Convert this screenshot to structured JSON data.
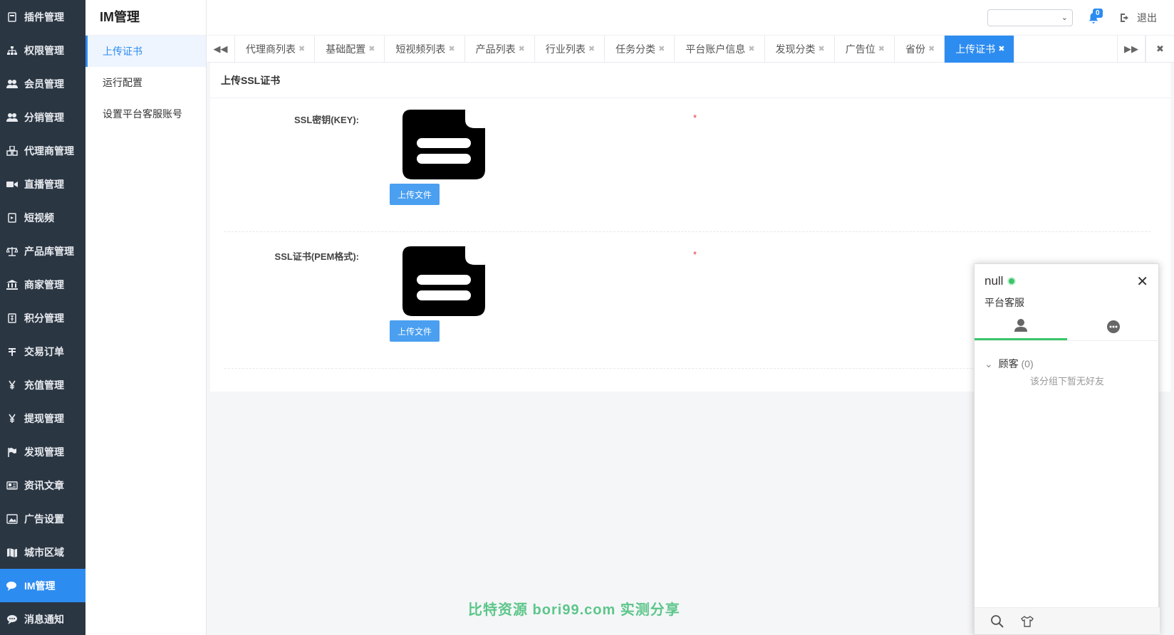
{
  "sidebar": {
    "items": [
      {
        "label": "插件管理",
        "icon": "plugin-icon"
      },
      {
        "label": "权限管理",
        "icon": "sitemap-icon"
      },
      {
        "label": "会员管理",
        "icon": "users-icon"
      },
      {
        "label": "分销管理",
        "icon": "users-icon"
      },
      {
        "label": "代理商管理",
        "icon": "cubes-icon"
      },
      {
        "label": "直播管理",
        "icon": "video-camera-icon"
      },
      {
        "label": "短视频",
        "icon": "video-file-icon"
      },
      {
        "label": "产品库管理",
        "icon": "balance-icon"
      },
      {
        "label": "商家管理",
        "icon": "bank-icon"
      },
      {
        "label": "积分管理",
        "icon": "points-file-icon"
      },
      {
        "label": "交易订单",
        "icon": "yen-order-icon"
      },
      {
        "label": "充值管理",
        "icon": "yen-icon"
      },
      {
        "label": "提现管理",
        "icon": "yen-icon"
      },
      {
        "label": "发现管理",
        "icon": "flag-icon"
      },
      {
        "label": "资讯文章",
        "icon": "newspaper-icon"
      },
      {
        "label": "广告设置",
        "icon": "image-icon"
      },
      {
        "label": "城市区域",
        "icon": "map-icon"
      },
      {
        "label": "IM管理",
        "icon": "comments-icon",
        "active": true
      },
      {
        "label": "消息通知",
        "icon": "comment-icon"
      }
    ]
  },
  "subnav": {
    "title": "IM管理",
    "items": [
      {
        "label": "上传证书",
        "active": true
      },
      {
        "label": "运行配置"
      },
      {
        "label": "设置平台客服账号"
      }
    ]
  },
  "topbar": {
    "select_value": "",
    "notification_count": "0",
    "logout_label": "退出"
  },
  "tabs": [
    {
      "label": "代理商列表"
    },
    {
      "label": "基础配置"
    },
    {
      "label": "短视频列表"
    },
    {
      "label": "产品列表"
    },
    {
      "label": "行业列表"
    },
    {
      "label": "任务分类"
    },
    {
      "label": "平台账户信息"
    },
    {
      "label": "发现分类"
    },
    {
      "label": "广告位"
    },
    {
      "label": "省份"
    },
    {
      "label": "上传证书",
      "active": true
    }
  ],
  "content": {
    "heading": "上传SSL证书",
    "fields": [
      {
        "label": "SSL密钥(KEY):",
        "button": "上传文件",
        "required_mark": "*"
      },
      {
        "label": "SSL证书(PEM格式):",
        "button": "上传文件",
        "required_mark": "*"
      }
    ]
  },
  "im_panel": {
    "name": "null",
    "signature": "平台客服",
    "group_name": "顾客",
    "group_count": "(0)",
    "empty_text": "该分组下暂无好友"
  },
  "watermark": "比特资源 bori99.com 实测分享",
  "colors": {
    "sidebar_bg": "#2b3643",
    "accent": "#2d8cf0",
    "online": "#3ac569",
    "required": "#e4393c"
  }
}
